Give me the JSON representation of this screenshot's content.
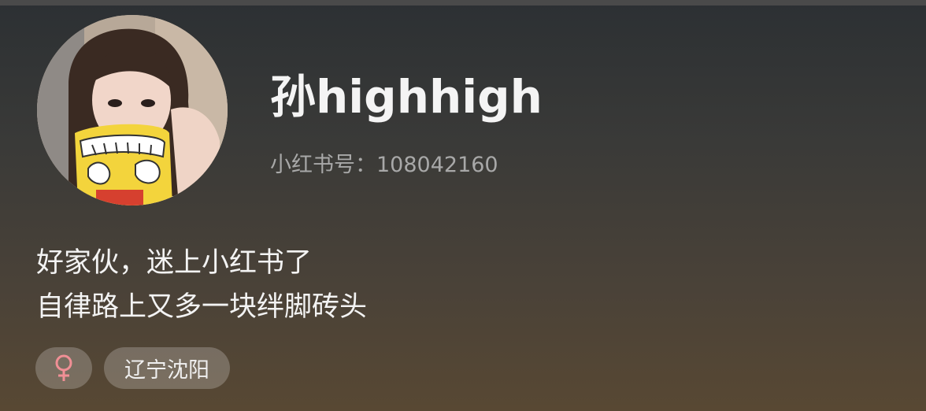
{
  "profile": {
    "nickname": "孙highhigh",
    "id_line": "小红书号：108042160",
    "avatar_icon": "user-avatar-photo"
  },
  "bio": {
    "lines": [
      "好家伙，迷上小红书了",
      "自律路上又多一块绊脚砖头"
    ]
  },
  "tags": {
    "gender_icon": "female-icon",
    "gender_color": "#f08f95",
    "location": "辽宁沈阳"
  },
  "colors": {
    "background_top": "#2c3033",
    "background_bottom": "#584833",
    "name_text": "#f4f4f4",
    "id_text": "#a8a8a8"
  }
}
